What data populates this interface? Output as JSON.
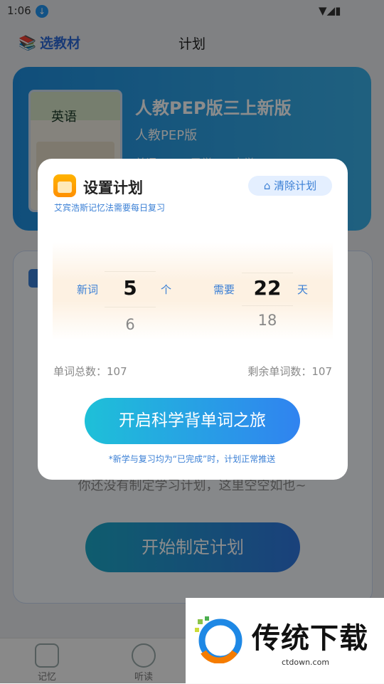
{
  "status_bar": {
    "time": "1:06"
  },
  "header": {
    "select_label": "选教材",
    "title": "计划"
  },
  "book": {
    "cover_title": "英语",
    "name": "人教PEP版三上新版",
    "publisher": "人教PEP版",
    "stats": "单词：107  已学：0  未学：107"
  },
  "plan_card": {
    "empty_text": "你还没有制定学习计划，这里空空如也~",
    "start_button": "开始制定计划"
  },
  "tabs": [
    {
      "label": "记忆"
    },
    {
      "label": "听读"
    }
  ],
  "modal": {
    "title": "设置计划",
    "subtitle": "艾宾浩斯记忆法需要每日复习",
    "clear_button": "清除计划",
    "new_words_label": "新词",
    "new_words_value": "5",
    "new_words_next": "6",
    "new_words_unit": "个",
    "days_label": "需要",
    "days_value": "22",
    "days_next": "18",
    "days_unit": "天",
    "total_words": "单词总数：107",
    "remaining_words": "剩余单词数：107",
    "journey_button": "开启科学背单词之旅",
    "footnote": "*新学与复习均为“已完成”时，计划正常推送"
  },
  "watermark": {
    "title": "传统下载",
    "url": "ctdown.com"
  },
  "colors": {
    "accent": "#3a7fd5",
    "card_blue": "#1e8fe0",
    "button_cyan": "#1ec0d8"
  }
}
